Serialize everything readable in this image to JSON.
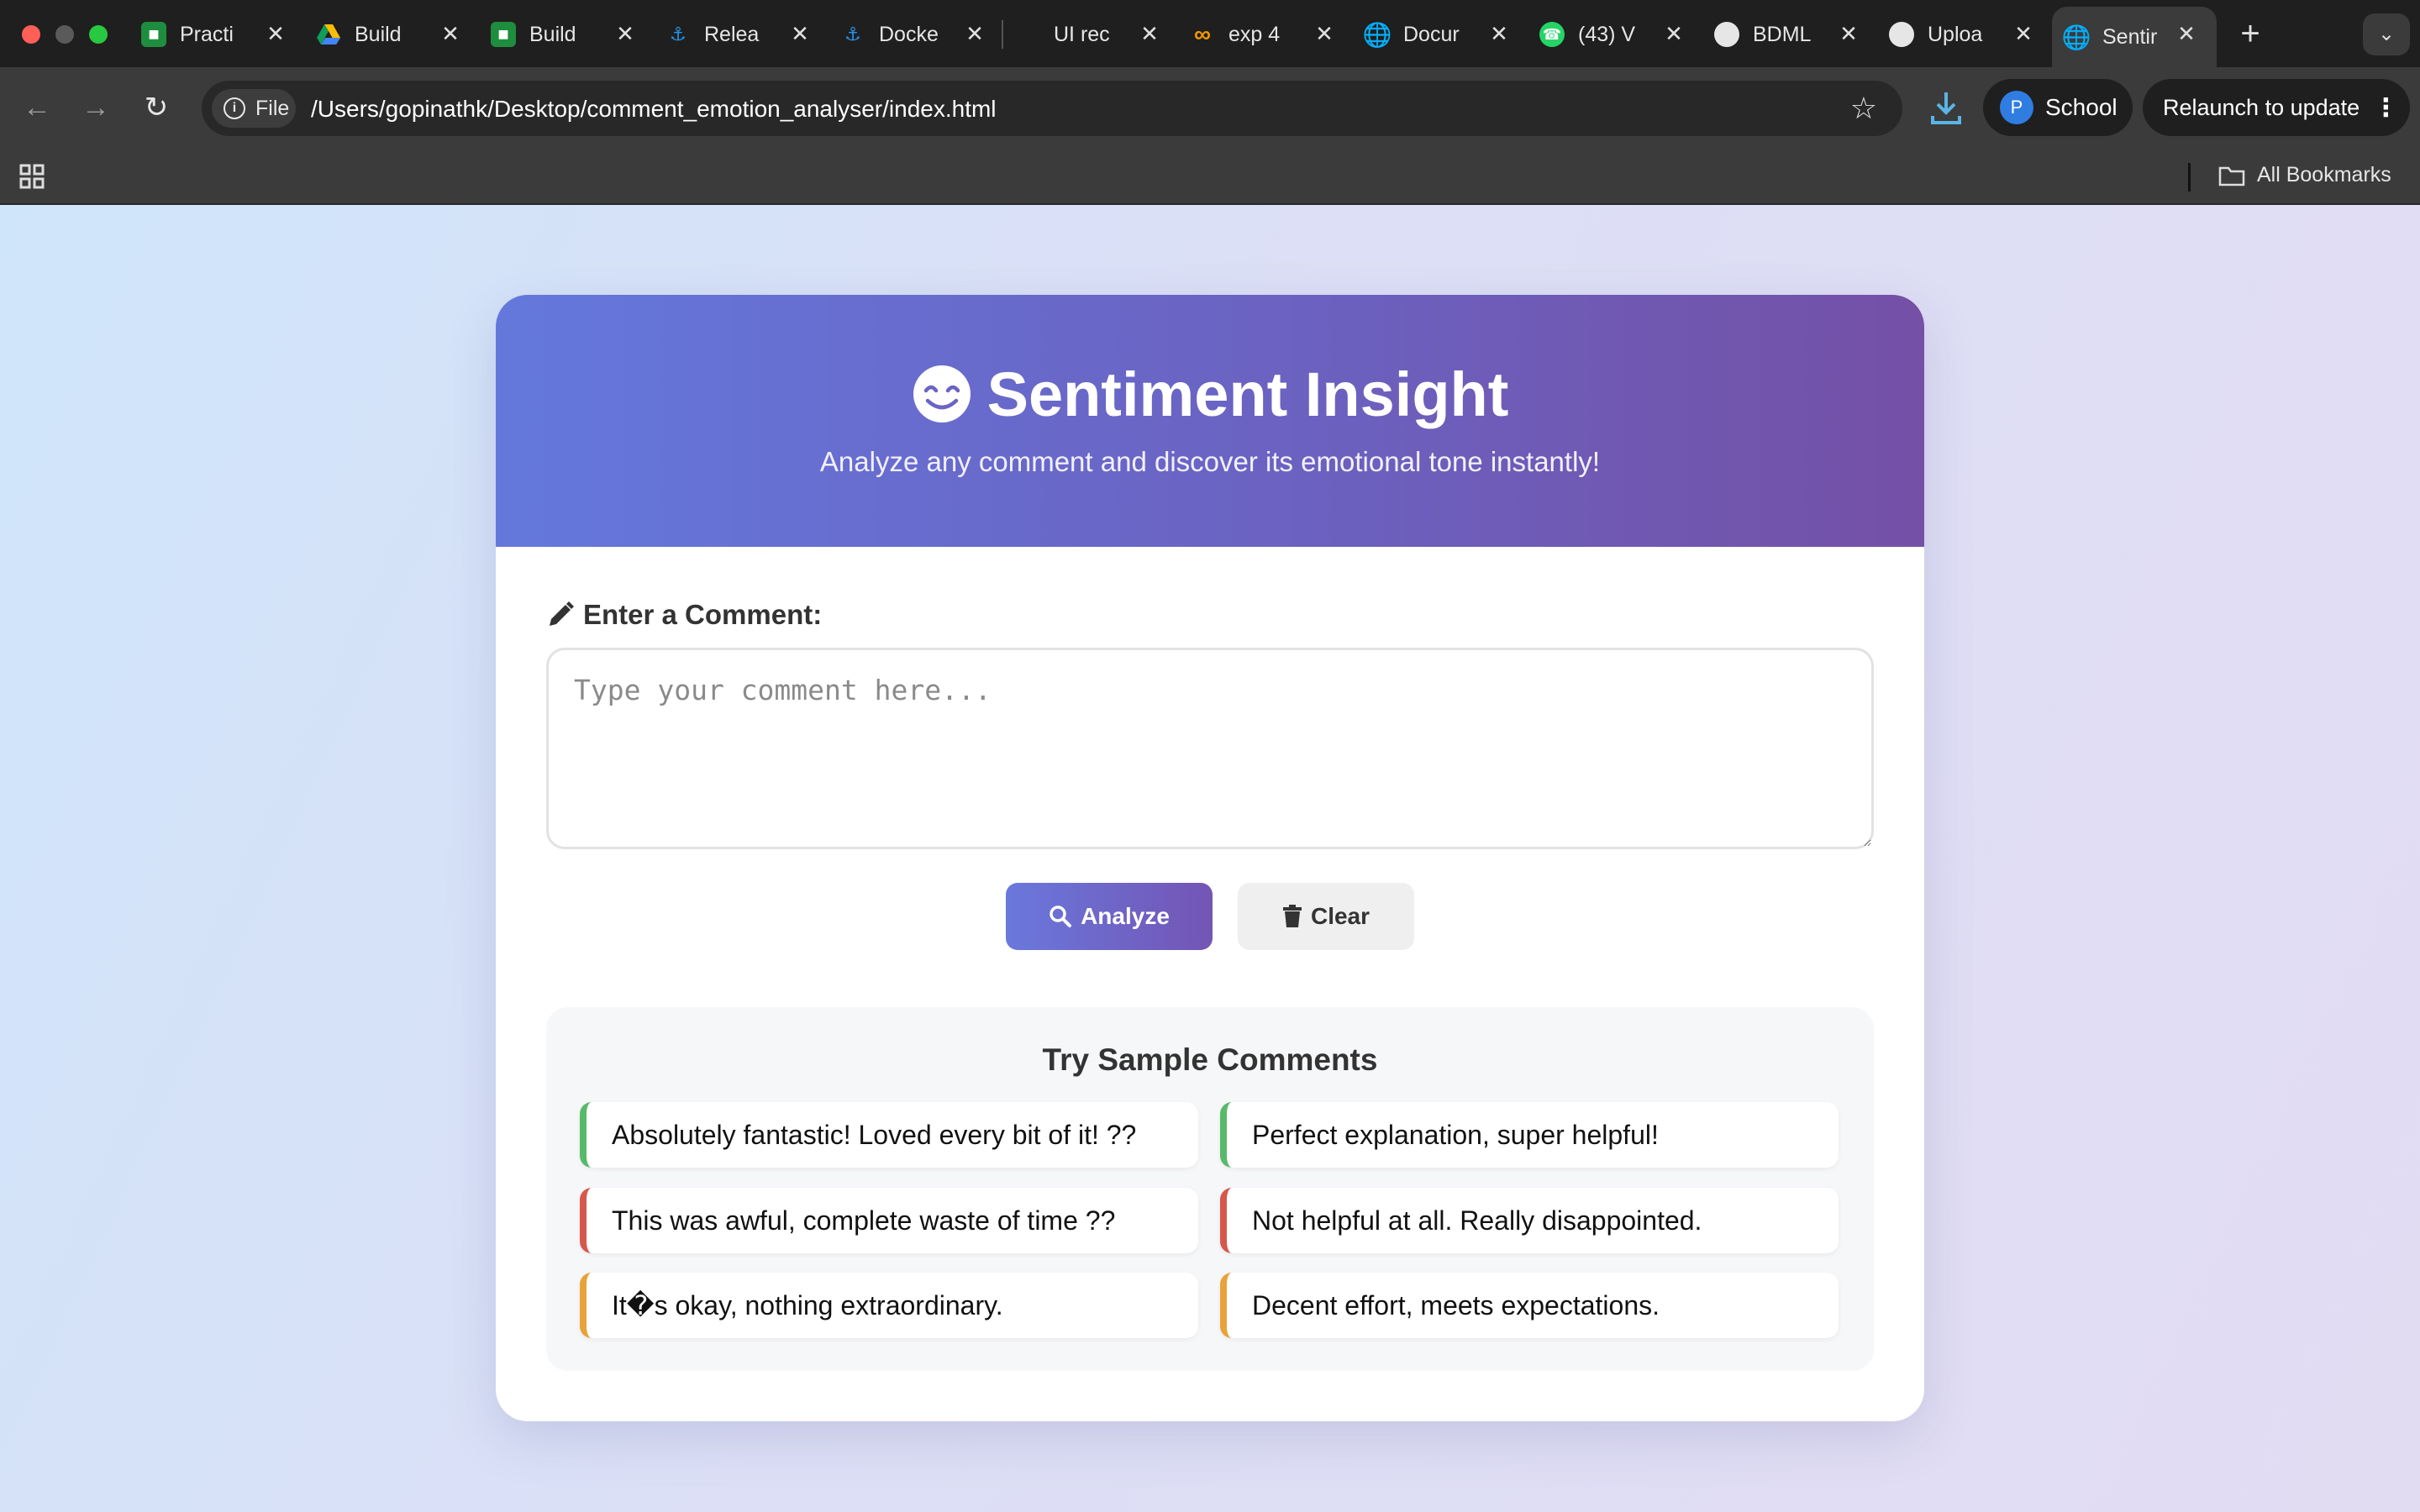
{
  "browser": {
    "tabs": [
      {
        "title": "Practi",
        "icon": "classroom-icon"
      },
      {
        "title": "Build",
        "icon": "drive-icon"
      },
      {
        "title": "Build",
        "icon": "classroom-icon"
      },
      {
        "title": "Relea",
        "icon": "docker-icon"
      },
      {
        "title": "Docke",
        "icon": "docker-icon"
      },
      {
        "title": "UI rec",
        "icon": "blank-icon"
      },
      {
        "title": "exp 4",
        "icon": "infinity-icon"
      },
      {
        "title": "Docur",
        "icon": "globe-icon"
      },
      {
        "title": "(43) V",
        "icon": "whatsapp-icon"
      },
      {
        "title": "BDML",
        "icon": "github-icon"
      },
      {
        "title": "Uploa",
        "icon": "github-icon"
      },
      {
        "title": "Sentir",
        "icon": "globe-icon",
        "active": true
      }
    ],
    "address": {
      "chip_label": "File",
      "url": "/Users/gopinathk/Desktop/comment_emotion_analyser/index.html"
    },
    "profile": {
      "initial": "P",
      "name": "School"
    },
    "relaunch_label": "Relaunch to update",
    "bookmarks_label": "All Bookmarks"
  },
  "app": {
    "title": "Sentiment Insight",
    "subtitle": "Analyze any comment and discover its emotional tone instantly!",
    "input_label": "Enter a Comment:",
    "input_placeholder": "Type your comment here...",
    "input_value": "",
    "analyze_label": "Analyze",
    "clear_label": "Clear",
    "samples_title": "Try Sample Comments",
    "samples": [
      {
        "text": "Absolutely fantastic! Loved every bit of it! ??",
        "tone": "positive"
      },
      {
        "text": "Perfect explanation, super helpful!",
        "tone": "positive"
      },
      {
        "text": "This was awful, complete waste of time ??",
        "tone": "negative"
      },
      {
        "text": "Not helpful at all. Really disappointed.",
        "tone": "negative"
      },
      {
        "text": "It�s okay, nothing extraordinary.",
        "tone": "neutral"
      },
      {
        "text": "Decent effort, meets expectations.",
        "tone": "neutral"
      }
    ]
  },
  "colors": {
    "positive": "#58b96b",
    "negative": "#d5584b",
    "neutral": "#e8a23c",
    "hero_start": "#6478dc",
    "hero_end": "#7450a6"
  }
}
